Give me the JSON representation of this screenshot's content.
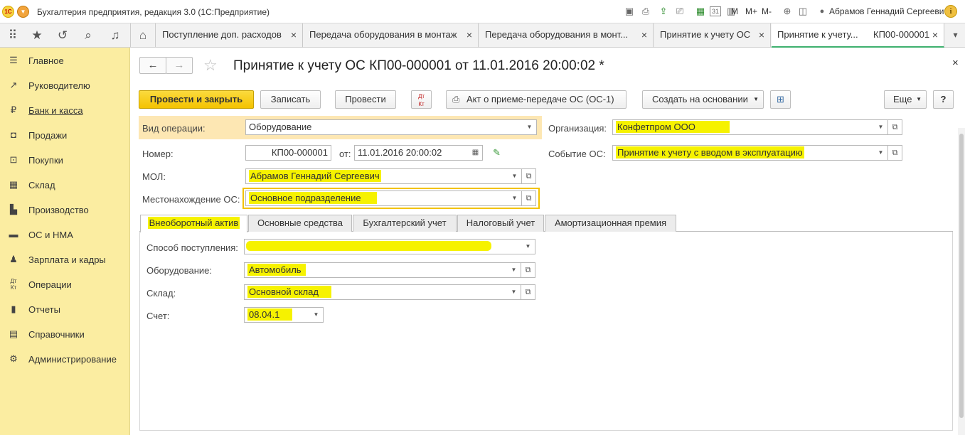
{
  "window": {
    "logo_text": "1С",
    "app_title": "Бухгалтерия предприятия, редакция 3.0   (1С:Предприятие)",
    "memory": {
      "m": "M",
      "m_plus": "M+",
      "m_minus": "M-"
    },
    "calendar_day": "31",
    "user": "Абрамов Геннадий Сергеевич"
  },
  "open_tabs": [
    {
      "label": "Поступление доп. расходов",
      "close": "×"
    },
    {
      "label": "Передача оборудования в монтаж",
      "close": "×"
    },
    {
      "label": "Передача оборудования в монт...",
      "close": "×"
    },
    {
      "label": "Принятие к учету ОС",
      "close": "×"
    },
    {
      "label": "Принятие к учету...",
      "number": "КП00-000001",
      "close": "×"
    }
  ],
  "tabs_more": "▾",
  "sidebar": {
    "items": [
      {
        "label": "Главное",
        "icon": "list-icon"
      },
      {
        "label": "Руководителю",
        "icon": "trend-icon"
      },
      {
        "label": "Банк и касса",
        "icon": "coin-icon"
      },
      {
        "label": "Продажи",
        "icon": "bag-icon"
      },
      {
        "label": "Покупки",
        "icon": "cart-icon"
      },
      {
        "label": "Склад",
        "icon": "grid-icon"
      },
      {
        "label": "Производство",
        "icon": "factory-icon"
      },
      {
        "label": "ОС и НМА",
        "icon": "truck-icon"
      },
      {
        "label": "Зарплата и кадры",
        "icon": "person-icon"
      },
      {
        "label": "Операции",
        "icon": "dt-kt-icon"
      },
      {
        "label": "Отчеты",
        "icon": "bar-chart-icon"
      },
      {
        "label": "Справочники",
        "icon": "book-icon"
      },
      {
        "label": "Администрирование",
        "icon": "gear-icon"
      }
    ]
  },
  "document": {
    "title": "Принятие к учету ОС КП00-000001 от 11.01.2016 20:00:02 *",
    "close": "×"
  },
  "toolbar": {
    "post_close": "Провести и закрыть",
    "save": "Записать",
    "post": "Провести",
    "dtkt_top": "Дт",
    "dtkt_bottom": "Кт",
    "act": "Акт о приеме-передаче ОС (ОС-1)",
    "create_based": "Создать на основании",
    "more": "Еще",
    "help": "?"
  },
  "form": {
    "operation_type": {
      "label": "Вид операции:",
      "value": "Оборудование"
    },
    "number": {
      "label": "Номер:",
      "value": "КП00-000001"
    },
    "date": {
      "label": "от:",
      "value": "11.01.2016 20:00:02"
    },
    "mol": {
      "label": "МОЛ:",
      "value": "Абрамов Геннадий Сергеевич"
    },
    "location": {
      "label": "Местонахождение ОС:",
      "value": "Основное подразделение"
    },
    "organization": {
      "label": "Организация:",
      "value": "Конфетпром ООО"
    },
    "event": {
      "label": "Событие ОС:",
      "value": "Принятие к учету с вводом в эксплуатацию"
    }
  },
  "form_tabs": [
    {
      "label": "Внеоборотный актив"
    },
    {
      "label": "Основные средства"
    },
    {
      "label": "Бухгалтерский учет"
    },
    {
      "label": "Налоговый учет"
    },
    {
      "label": "Амортизационная премия"
    }
  ],
  "asset_tab": {
    "receipt_method": {
      "label": "Способ поступления:",
      "value": ""
    },
    "equipment": {
      "label": "Оборудование:",
      "value": "Автомобиль"
    },
    "warehouse": {
      "label": "Склад:",
      "value": "Основной склад"
    },
    "account": {
      "label": "Счет:",
      "value": "08.04.1"
    }
  },
  "colors": {
    "sidebar_bg": "#fbeda1",
    "primary_button": "#f4c300",
    "highlight": "#f6f200",
    "active_tab_underline": "#3eb06e"
  }
}
